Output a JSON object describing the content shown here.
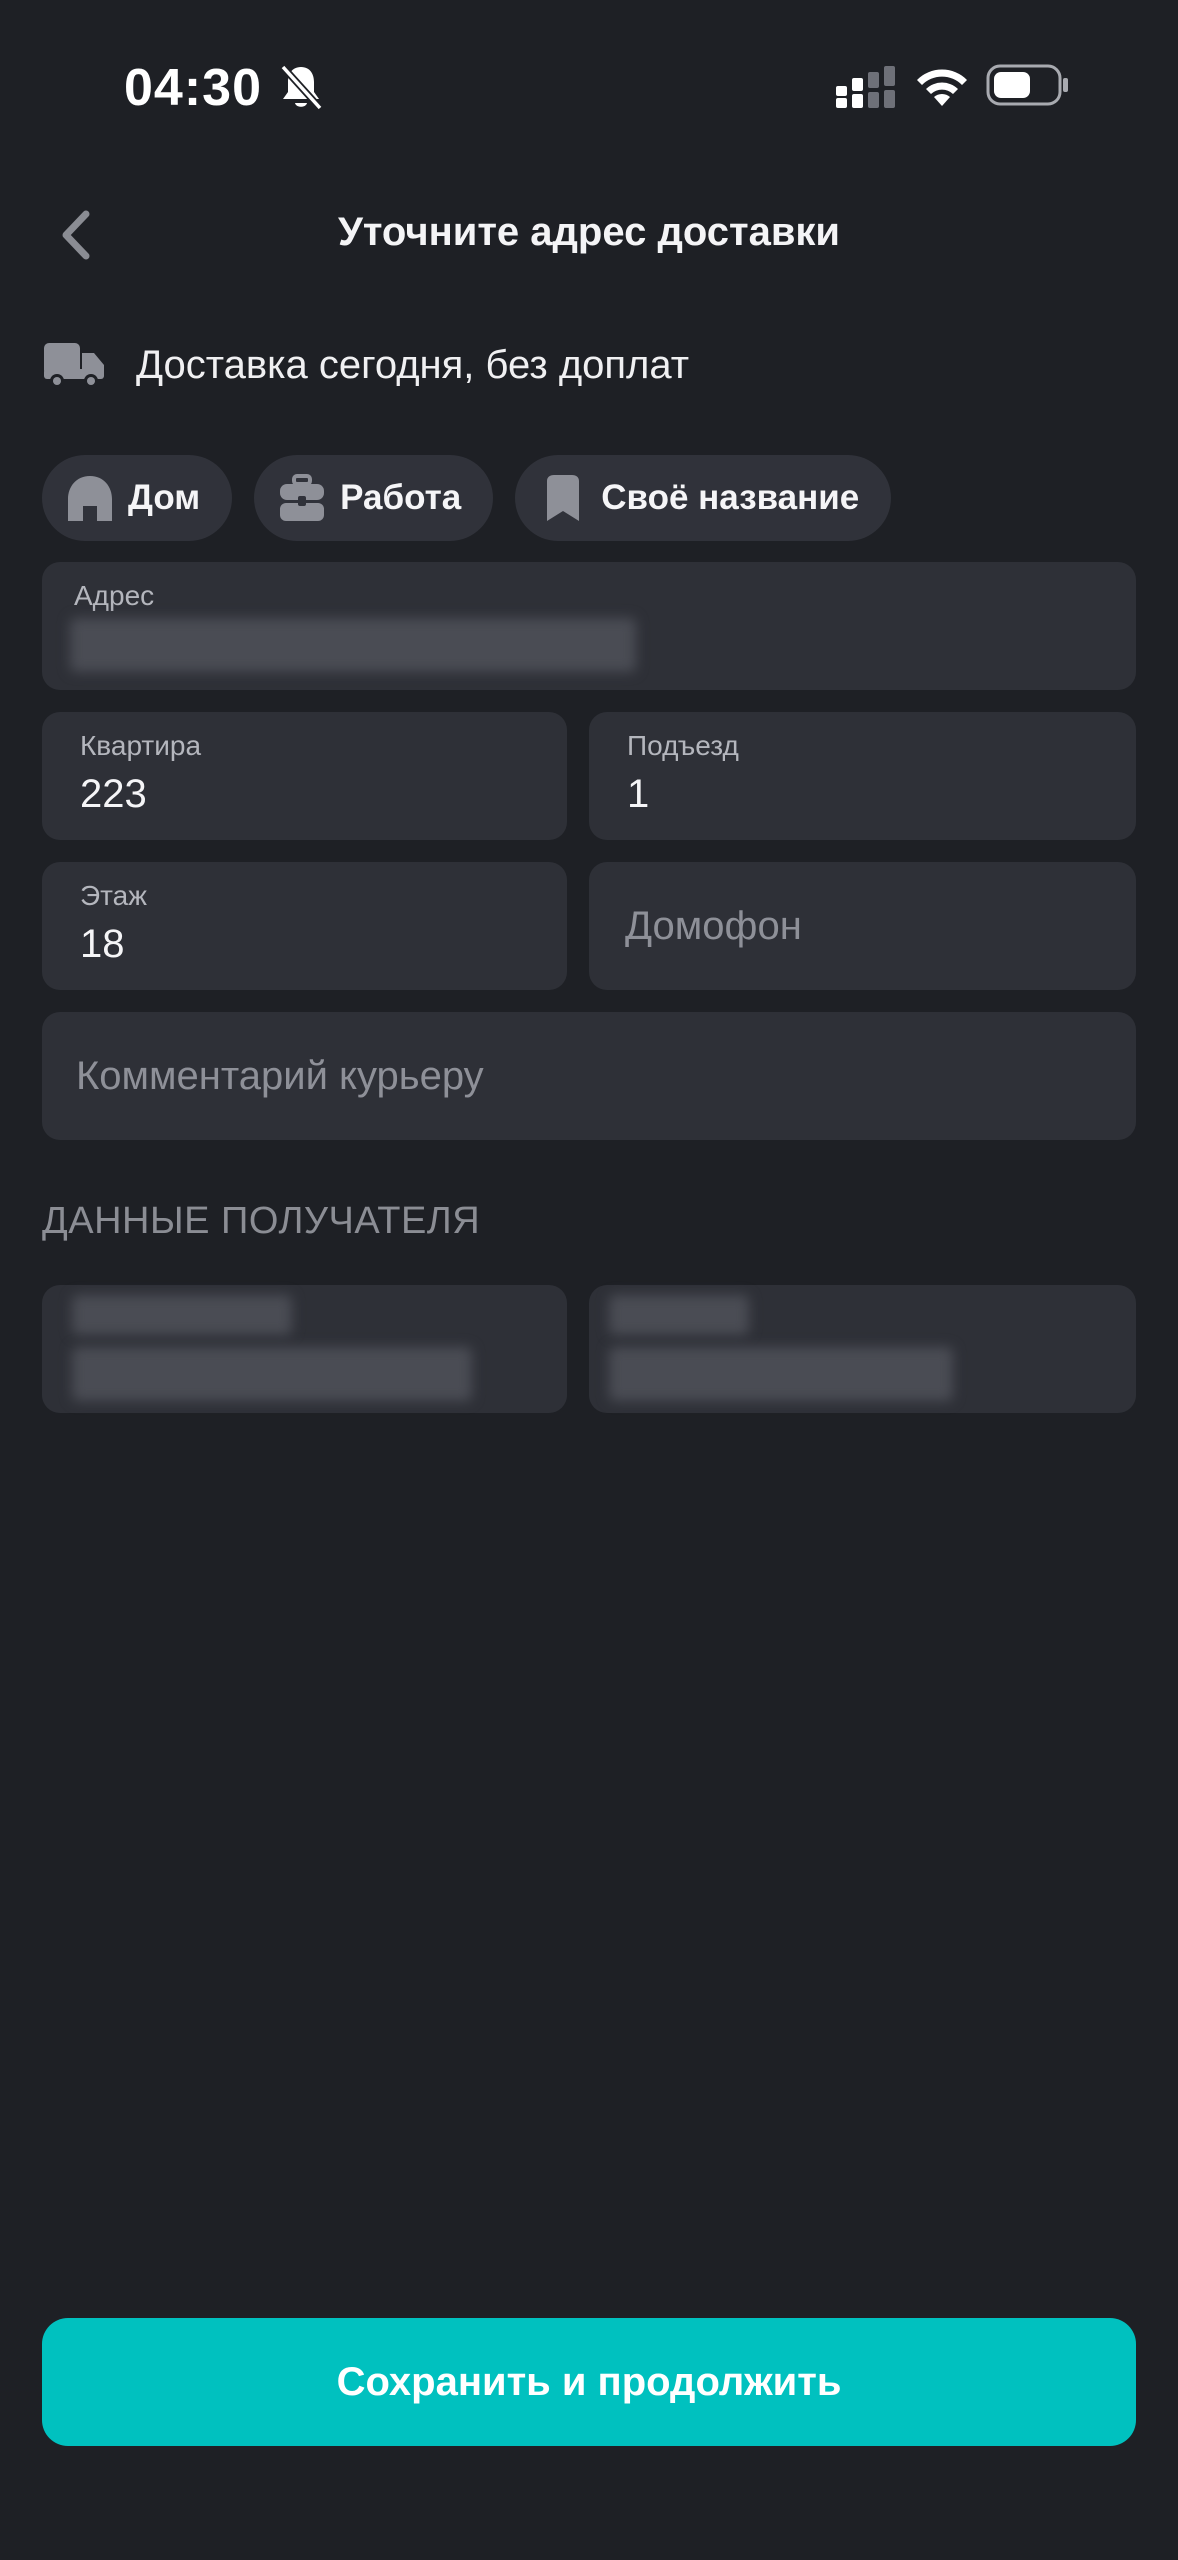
{
  "status_bar": {
    "time": "04:30"
  },
  "header": {
    "title": "Уточните адрес доставки"
  },
  "delivery": {
    "text": "Доставка сегодня, без доплат"
  },
  "chips": [
    {
      "label": "Дом",
      "icon": "home-icon"
    },
    {
      "label": "Работа",
      "icon": "briefcase-icon"
    },
    {
      "label": "Своё название",
      "icon": "bookmark-icon"
    }
  ],
  "form": {
    "address": {
      "label": "Адрес"
    },
    "apartment": {
      "label": "Квартира",
      "value": "223"
    },
    "entrance": {
      "label": "Подъезд",
      "value": "1"
    },
    "floor": {
      "label": "Этаж",
      "value": "18"
    },
    "intercom": {
      "placeholder": "Домофон"
    },
    "comment": {
      "placeholder": "Комментарий курьеру"
    }
  },
  "recipient": {
    "section_title": "ДАННЫЕ ПОЛУЧАТЕЛЯ"
  },
  "footer": {
    "save_label": "Сохранить и продолжить"
  },
  "colors": {
    "background": "#1e2025",
    "field": "#2e3037",
    "accent": "#00c1bf"
  }
}
